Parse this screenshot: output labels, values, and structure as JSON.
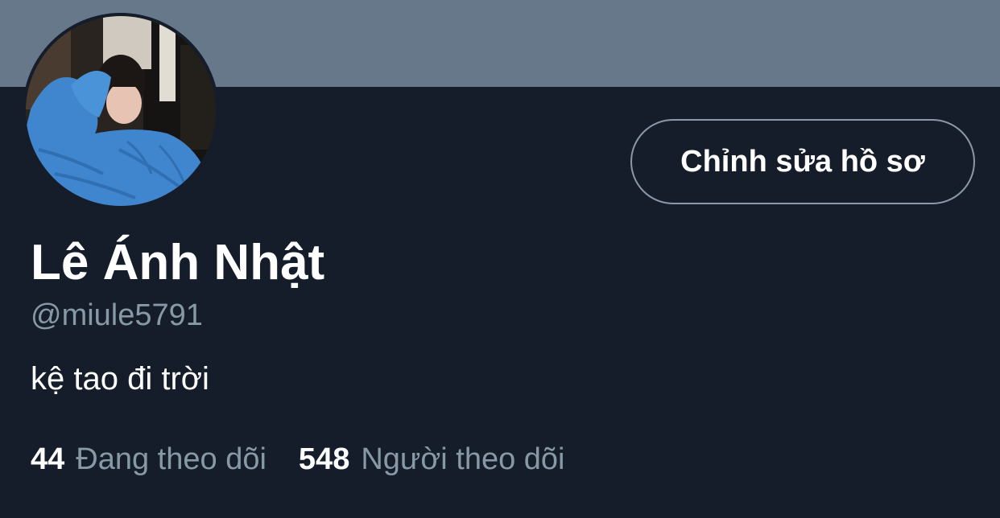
{
  "profile": {
    "display_name": "Lê Ánh Nhật",
    "handle": "@miule5791",
    "bio": "kệ tao đi trời",
    "avatar_icon": "profile-photo",
    "edit_profile_label": "Chỉnh sửa hồ sơ"
  },
  "stats": {
    "following_count": "44",
    "following_label": "Đang theo dõi",
    "followers_count": "548",
    "followers_label": "Người theo dõi"
  },
  "colors": {
    "banner": "#66788a",
    "background": "#151d2b",
    "secondary_text": "#8899a6",
    "button_border": "#8a98a8"
  }
}
